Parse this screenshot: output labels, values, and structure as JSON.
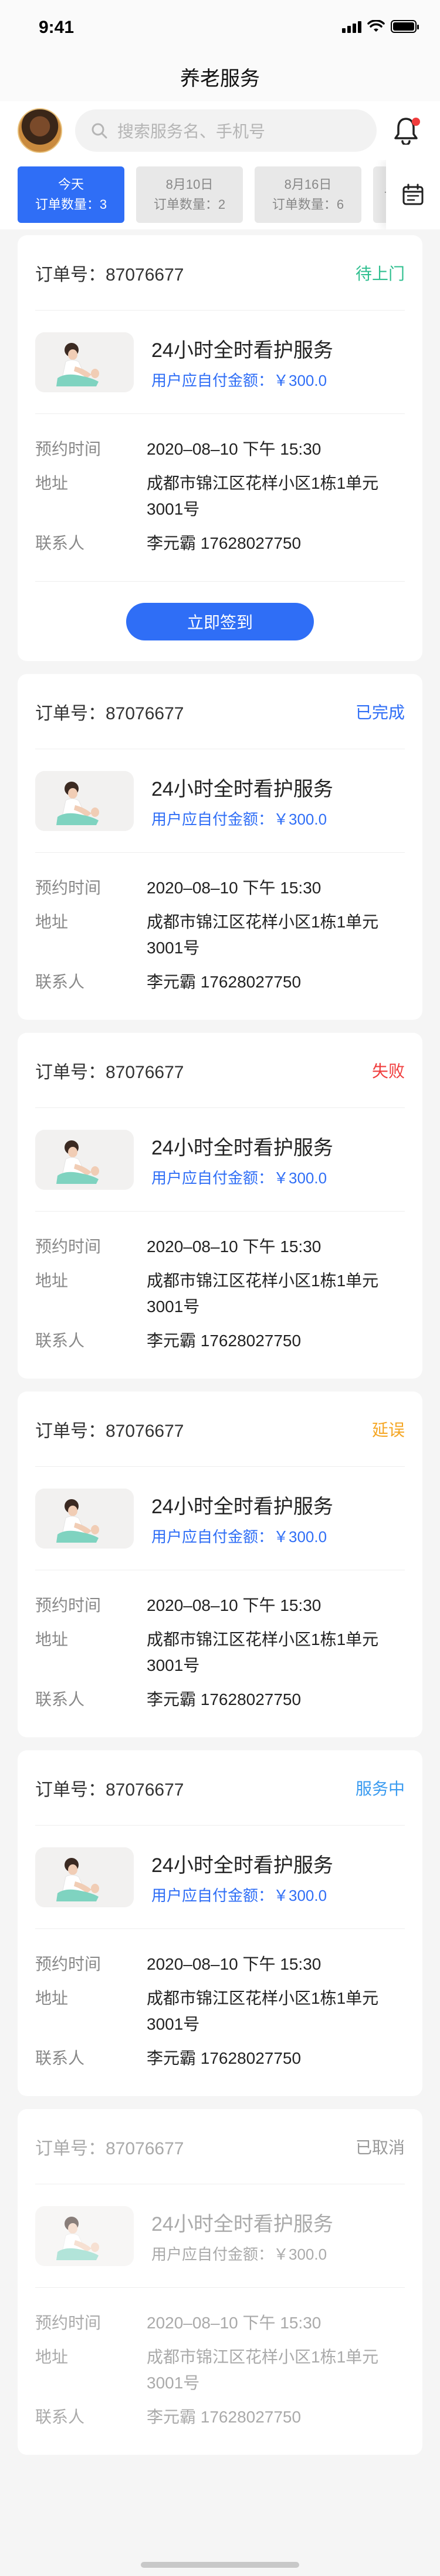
{
  "status_bar": {
    "time": "9:41"
  },
  "nav": {
    "title": "养老服务"
  },
  "search": {
    "placeholder": "搜索服务名、手机号"
  },
  "date_tabs": [
    {
      "day": "今天",
      "count_label": "订单数量：3",
      "active": true
    },
    {
      "day": "8月10日",
      "count_label": "订单数量：2",
      "active": false
    },
    {
      "day": "8月16日",
      "count_label": "订单数量：6",
      "active": false
    },
    {
      "day": "",
      "count_label": "讠",
      "active": false
    }
  ],
  "colors": {
    "accent": "#2f6ef6",
    "status_pending": "#2fbf8f",
    "status_done": "#2f6ef6",
    "status_failed": "#f03c3c",
    "status_delayed": "#f5a623",
    "status_in_service": "#3a9bf0",
    "status_cancelled": "#999999"
  },
  "orders": [
    {
      "order_label": "订单号：87076677",
      "status": "待上门",
      "status_key": "status_pending",
      "service_name": "24小时全时看护服务",
      "price_label": "用户应自付金额：￥300.0",
      "fields": [
        {
          "label": "预约时间",
          "value": "2020–08–10 下午 15:30"
        },
        {
          "label": "地址",
          "value": "成都市锦江区花样小区1栋1单元3001号"
        },
        {
          "label": "联系人",
          "value": "李元霸  17628027750"
        }
      ],
      "action_label": "立即签到"
    },
    {
      "order_label": "订单号：87076677",
      "status": "已完成",
      "status_key": "status_done",
      "service_name": "24小时全时看护服务",
      "price_label": "用户应自付金额：￥300.0",
      "fields": [
        {
          "label": "预约时间",
          "value": "2020–08–10 下午 15:30"
        },
        {
          "label": "地址",
          "value": "成都市锦江区花样小区1栋1单元3001号"
        },
        {
          "label": "联系人",
          "value": "李元霸  17628027750"
        }
      ]
    },
    {
      "order_label": "订单号：87076677",
      "status": "失败",
      "status_key": "status_failed",
      "service_name": "24小时全时看护服务",
      "price_label": "用户应自付金额：￥300.0",
      "fields": [
        {
          "label": "预约时间",
          "value": "2020–08–10 下午 15:30"
        },
        {
          "label": "地址",
          "value": "成都市锦江区花样小区1栋1单元3001号"
        },
        {
          "label": "联系人",
          "value": "李元霸  17628027750"
        }
      ]
    },
    {
      "order_label": "订单号：87076677",
      "status": "延误",
      "status_key": "status_delayed",
      "service_name": "24小时全时看护服务",
      "price_label": "用户应自付金额：￥300.0",
      "fields": [
        {
          "label": "预约时间",
          "value": "2020–08–10 下午 15:30"
        },
        {
          "label": "地址",
          "value": "成都市锦江区花样小区1栋1单元3001号"
        },
        {
          "label": "联系人",
          "value": "李元霸  17628027750"
        }
      ]
    },
    {
      "order_label": "订单号：87076677",
      "status": "服务中",
      "status_key": "status_in_service",
      "service_name": "24小时全时看护服务",
      "price_label": "用户应自付金额：￥300.0",
      "fields": [
        {
          "label": "预约时间",
          "value": "2020–08–10 下午 15:30"
        },
        {
          "label": "地址",
          "value": "成都市锦江区花样小区1栋1单元3001号"
        },
        {
          "label": "联系人",
          "value": "李元霸  17628027750"
        }
      ]
    },
    {
      "order_label": "订单号：87076677",
      "status": "已取消",
      "status_key": "status_cancelled",
      "service_name": "24小时全时看护服务",
      "price_label": "用户应自付金额：￥300.0",
      "fields": [
        {
          "label": "预约时间",
          "value": "2020–08–10 下午 15:30"
        },
        {
          "label": "地址",
          "value": "成都市锦江区花样小区1栋1单元3001号"
        },
        {
          "label": "联系人",
          "value": "李元霸  17628027750"
        }
      ]
    }
  ]
}
